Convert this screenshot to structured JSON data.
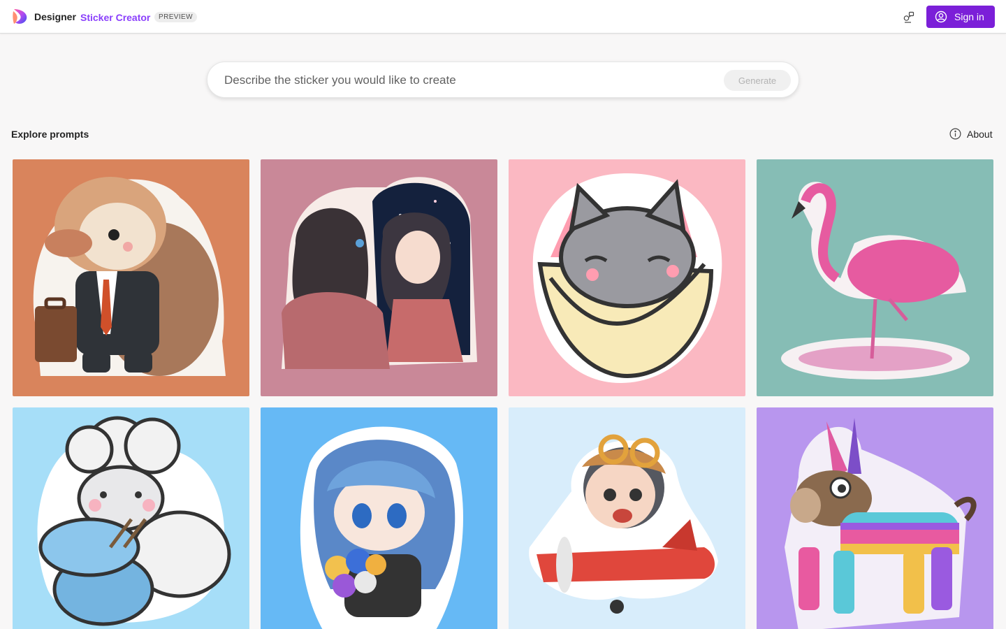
{
  "header": {
    "brand": "Designer",
    "product": "Sticker Creator",
    "badge": "PREVIEW",
    "signin_label": "Sign in",
    "accent_color": "#7b1fd8"
  },
  "prompt": {
    "placeholder": "Describe the sticker you would like to create",
    "value": "",
    "generate_label": "Generate"
  },
  "explore": {
    "title": "Explore prompts",
    "about_label": "About"
  },
  "gallery": [
    {
      "subject": "platypus-businessman",
      "bg": "#d9845c"
    },
    {
      "subject": "girl-galaxy-mirror",
      "bg": "#c98898"
    },
    {
      "subject": "cat-burrito",
      "bg": "#fbb8c2"
    },
    {
      "subject": "pink-flamingo",
      "bg": "#86bdb5"
    },
    {
      "subject": "knitting-sheep",
      "bg": "#a6def8"
    },
    {
      "subject": "anime-boy-bouquet",
      "bg": "#66b9f5"
    },
    {
      "subject": "pilot-kid-airplane",
      "bg": "#d8edfb"
    },
    {
      "subject": "donkey-pinata",
      "bg": "#b896ee"
    }
  ]
}
